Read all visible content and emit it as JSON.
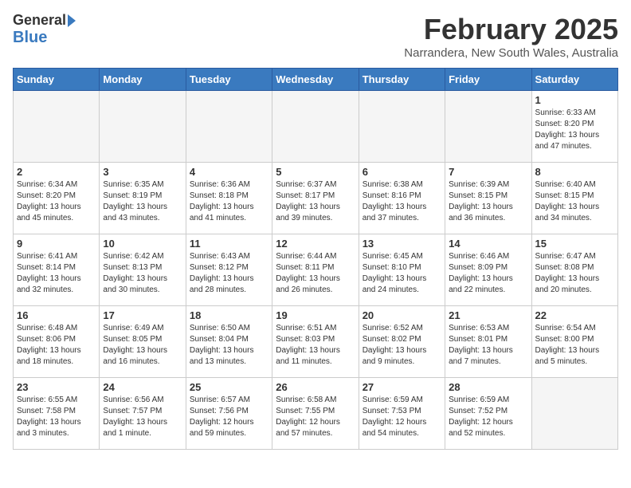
{
  "logo": {
    "line1": "General",
    "line2": "Blue"
  },
  "header": {
    "month": "February 2025",
    "location": "Narrandera, New South Wales, Australia"
  },
  "weekdays": [
    "Sunday",
    "Monday",
    "Tuesday",
    "Wednesday",
    "Thursday",
    "Friday",
    "Saturday"
  ],
  "weeks": [
    [
      {
        "day": "",
        "info": ""
      },
      {
        "day": "",
        "info": ""
      },
      {
        "day": "",
        "info": ""
      },
      {
        "day": "",
        "info": ""
      },
      {
        "day": "",
        "info": ""
      },
      {
        "day": "",
        "info": ""
      },
      {
        "day": "1",
        "info": "Sunrise: 6:33 AM\nSunset: 8:20 PM\nDaylight: 13 hours and 47 minutes."
      }
    ],
    [
      {
        "day": "2",
        "info": "Sunrise: 6:34 AM\nSunset: 8:20 PM\nDaylight: 13 hours and 45 minutes."
      },
      {
        "day": "3",
        "info": "Sunrise: 6:35 AM\nSunset: 8:19 PM\nDaylight: 13 hours and 43 minutes."
      },
      {
        "day": "4",
        "info": "Sunrise: 6:36 AM\nSunset: 8:18 PM\nDaylight: 13 hours and 41 minutes."
      },
      {
        "day": "5",
        "info": "Sunrise: 6:37 AM\nSunset: 8:17 PM\nDaylight: 13 hours and 39 minutes."
      },
      {
        "day": "6",
        "info": "Sunrise: 6:38 AM\nSunset: 8:16 PM\nDaylight: 13 hours and 37 minutes."
      },
      {
        "day": "7",
        "info": "Sunrise: 6:39 AM\nSunset: 8:15 PM\nDaylight: 13 hours and 36 minutes."
      },
      {
        "day": "8",
        "info": "Sunrise: 6:40 AM\nSunset: 8:15 PM\nDaylight: 13 hours and 34 minutes."
      }
    ],
    [
      {
        "day": "9",
        "info": "Sunrise: 6:41 AM\nSunset: 8:14 PM\nDaylight: 13 hours and 32 minutes."
      },
      {
        "day": "10",
        "info": "Sunrise: 6:42 AM\nSunset: 8:13 PM\nDaylight: 13 hours and 30 minutes."
      },
      {
        "day": "11",
        "info": "Sunrise: 6:43 AM\nSunset: 8:12 PM\nDaylight: 13 hours and 28 minutes."
      },
      {
        "day": "12",
        "info": "Sunrise: 6:44 AM\nSunset: 8:11 PM\nDaylight: 13 hours and 26 minutes."
      },
      {
        "day": "13",
        "info": "Sunrise: 6:45 AM\nSunset: 8:10 PM\nDaylight: 13 hours and 24 minutes."
      },
      {
        "day": "14",
        "info": "Sunrise: 6:46 AM\nSunset: 8:09 PM\nDaylight: 13 hours and 22 minutes."
      },
      {
        "day": "15",
        "info": "Sunrise: 6:47 AM\nSunset: 8:08 PM\nDaylight: 13 hours and 20 minutes."
      }
    ],
    [
      {
        "day": "16",
        "info": "Sunrise: 6:48 AM\nSunset: 8:06 PM\nDaylight: 13 hours and 18 minutes."
      },
      {
        "day": "17",
        "info": "Sunrise: 6:49 AM\nSunset: 8:05 PM\nDaylight: 13 hours and 16 minutes."
      },
      {
        "day": "18",
        "info": "Sunrise: 6:50 AM\nSunset: 8:04 PM\nDaylight: 13 hours and 13 minutes."
      },
      {
        "day": "19",
        "info": "Sunrise: 6:51 AM\nSunset: 8:03 PM\nDaylight: 13 hours and 11 minutes."
      },
      {
        "day": "20",
        "info": "Sunrise: 6:52 AM\nSunset: 8:02 PM\nDaylight: 13 hours and 9 minutes."
      },
      {
        "day": "21",
        "info": "Sunrise: 6:53 AM\nSunset: 8:01 PM\nDaylight: 13 hours and 7 minutes."
      },
      {
        "day": "22",
        "info": "Sunrise: 6:54 AM\nSunset: 8:00 PM\nDaylight: 13 hours and 5 minutes."
      }
    ],
    [
      {
        "day": "23",
        "info": "Sunrise: 6:55 AM\nSunset: 7:58 PM\nDaylight: 13 hours and 3 minutes."
      },
      {
        "day": "24",
        "info": "Sunrise: 6:56 AM\nSunset: 7:57 PM\nDaylight: 13 hours and 1 minute."
      },
      {
        "day": "25",
        "info": "Sunrise: 6:57 AM\nSunset: 7:56 PM\nDaylight: 12 hours and 59 minutes."
      },
      {
        "day": "26",
        "info": "Sunrise: 6:58 AM\nSunset: 7:55 PM\nDaylight: 12 hours and 57 minutes."
      },
      {
        "day": "27",
        "info": "Sunrise: 6:59 AM\nSunset: 7:53 PM\nDaylight: 12 hours and 54 minutes."
      },
      {
        "day": "28",
        "info": "Sunrise: 6:59 AM\nSunset: 7:52 PM\nDaylight: 12 hours and 52 minutes."
      },
      {
        "day": "",
        "info": ""
      }
    ]
  ]
}
